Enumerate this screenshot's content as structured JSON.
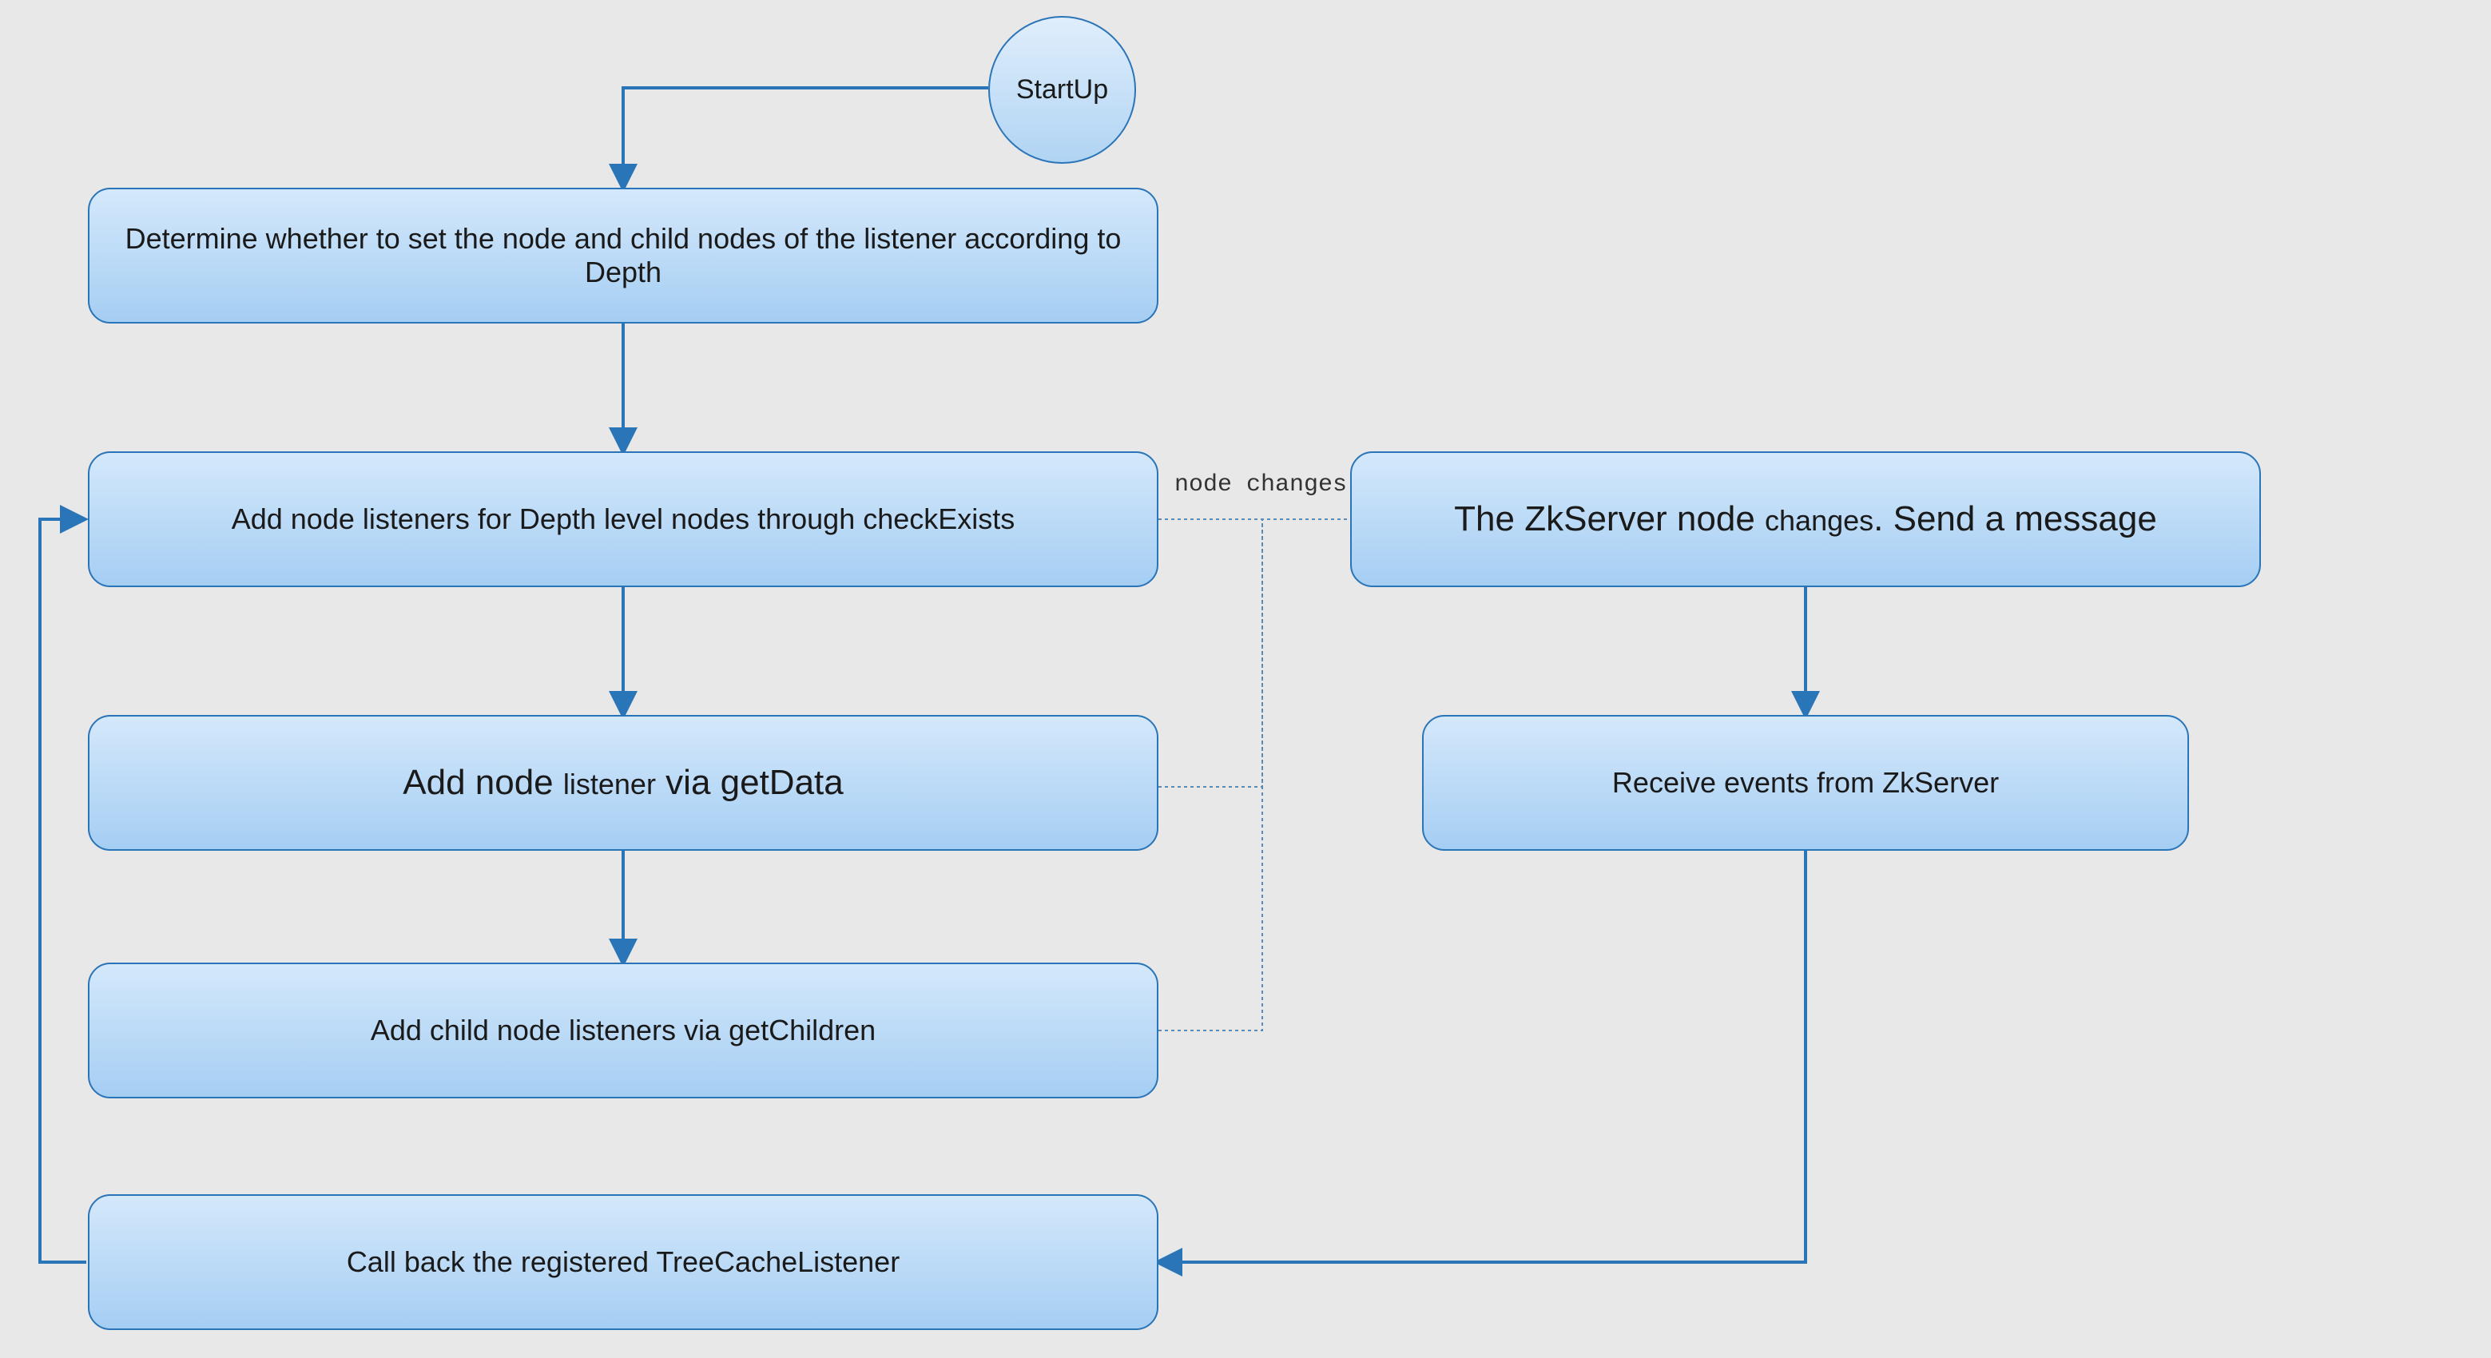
{
  "nodes": {
    "startup": "StartUp",
    "determine": "Determine whether to set the node and child nodes of the listener according to Depth",
    "checkExists": "Add node listeners for Depth level nodes through checkExists",
    "getData_a": "Add node ",
    "getData_b": "listener",
    "getData_c": " via getData",
    "getChildren": "Add child node listeners via getChildren",
    "zkChange_a": "The ZkServer node ",
    "zkChange_b": "changes",
    "zkChange_c": ". Send a message",
    "receive": "Receive events from ZkServer",
    "callback": "Call back the registered TreeCacheListener"
  },
  "edges": {
    "nodeChanges": "node changes"
  },
  "colors": {
    "stroke": "#2a74b8",
    "dotted": "#5a8bb8",
    "bg": "#e8e8e8"
  }
}
